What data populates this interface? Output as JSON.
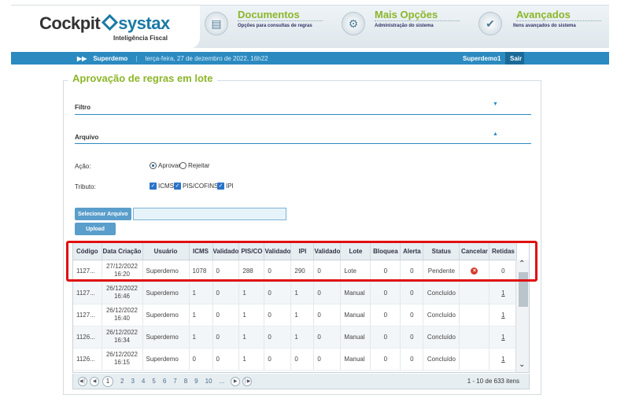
{
  "header": {
    "logo_main": "Cockpit",
    "logo_brand": "systax",
    "logo_sub": "Inteligência Fiscal",
    "nav": [
      {
        "title": "Documentos",
        "subtitle": "Opções para consultas de regras",
        "icon": "document-icon"
      },
      {
        "title": "Mais Opções",
        "subtitle": "Administração do sistema",
        "icon": "gear-icon"
      },
      {
        "title": "Avançados",
        "subtitle": "Itens avançados do sistema",
        "icon": "checkmark-icon"
      }
    ]
  },
  "topbar": {
    "user": "Superdemo",
    "separator": "|",
    "date": "terça-feira, 27 de dezembro de 2022, 16h22",
    "right_user": "Superdemo1",
    "logout": "Sair"
  },
  "panel": {
    "title": "Aprovação de regras em lote",
    "filtro": "Filtro",
    "arquivo": "Arquivo",
    "acao_label": "Ação:",
    "acao_options": [
      {
        "label": "Aprovar",
        "selected": true
      },
      {
        "label": "Rejeitar",
        "selected": false
      }
    ],
    "tributo_label": "Tributo:",
    "tributo_options": [
      {
        "label": "ICMS",
        "checked": true
      },
      {
        "label": "PIS/COFINS",
        "checked": true
      },
      {
        "label": "IPI",
        "checked": true
      }
    ],
    "select_file": "Selecionar Arquivo",
    "upload": "Upload"
  },
  "grid": {
    "columns": [
      "Código",
      "Data Criação",
      "Usuário",
      "ICMS",
      "Validado",
      "PIS/CO",
      "Validado",
      "IPI",
      "Validado",
      "Lote",
      "Bloquea",
      "Alerta",
      "Status",
      "Cancelar",
      "Retidas"
    ],
    "rows": [
      {
        "codigo": "1127...",
        "data1": "27/12/2022",
        "data2": "16:20",
        "usuario": "Superdemo",
        "icms": "1078",
        "v1": "0",
        "pis": "288",
        "v2": "0",
        "ipi": "290",
        "v3": "0",
        "lote": "Lote",
        "bloq": "0",
        "alerta": "0",
        "status": "Pendente",
        "cancelar": true,
        "retidas": "0"
      },
      {
        "codigo": "1127...",
        "data1": "26/12/2022",
        "data2": "16:46",
        "usuario": "Superdemo",
        "icms": "1",
        "v1": "0",
        "pis": "1",
        "v2": "0",
        "ipi": "1",
        "v3": "0",
        "lote": "Manual",
        "bloq": "0",
        "alerta": "0",
        "status": "Concluído",
        "cancelar": false,
        "retidas": "1"
      },
      {
        "codigo": "1127...",
        "data1": "26/12/2022",
        "data2": "16:40",
        "usuario": "Superdemo",
        "icms": "1",
        "v1": "0",
        "pis": "1",
        "v2": "0",
        "ipi": "1",
        "v3": "0",
        "lote": "Manual",
        "bloq": "0",
        "alerta": "0",
        "status": "Concluído",
        "cancelar": false,
        "retidas": "1"
      },
      {
        "codigo": "1126...",
        "data1": "26/12/2022",
        "data2": "16:34",
        "usuario": "Superdemo",
        "icms": "1",
        "v1": "0",
        "pis": "1",
        "v2": "0",
        "ipi": "1",
        "v3": "0",
        "lote": "Manual",
        "bloq": "0",
        "alerta": "0",
        "status": "Concluído",
        "cancelar": false,
        "retidas": "1"
      },
      {
        "codigo": "1126...",
        "data1": "26/12/2022",
        "data2": "16:15",
        "usuario": "Superdemo",
        "icms": "0",
        "v1": "0",
        "pis": "1",
        "v2": "0",
        "ipi": "0",
        "v3": "0",
        "lote": "Manual",
        "bloq": "0",
        "alerta": "0",
        "status": "Concluído",
        "cancelar": false,
        "retidas": "1"
      }
    ]
  },
  "pager": {
    "pages": [
      "1",
      "2",
      "3",
      "4",
      "5",
      "6",
      "7",
      "8",
      "9",
      "10",
      "..."
    ],
    "current": "1",
    "info": "1 - 10 de 633 itens"
  },
  "colors": {
    "accent": "#2b8ac0",
    "title_green": "#8cb629",
    "highlight": "#e01010"
  }
}
